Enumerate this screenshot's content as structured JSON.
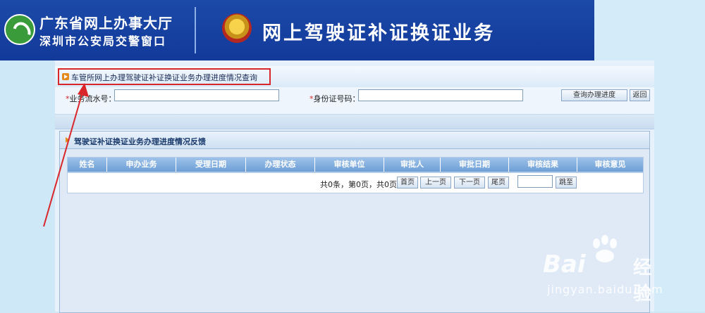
{
  "banner": {
    "portal_line1": "广东省网上办事大厅",
    "portal_line2": "深圳市公安局交警窗口",
    "service_title": "网上驾驶证补证换证业务"
  },
  "breadcrumb": {
    "text": "车管所网上办理驾驶证补证换证业务办理进度情况查询"
  },
  "search": {
    "serial_label": "业务流水号：",
    "serial_value": "",
    "id_label": "身份证号码：",
    "id_value": "",
    "query_button": "查询办理进度",
    "back_button": "返回"
  },
  "results": {
    "title": "驾驶证补证换证业务办理进度情况反馈",
    "columns": [
      "姓名",
      "申办业务",
      "受理日期",
      "办理状态",
      "审核单位",
      "审批人",
      "审批日期",
      "审核结果",
      "审核意见"
    ],
    "rows": []
  },
  "pagination": {
    "info": "共0条，第0页，共0页",
    "first": "首页",
    "prev": "上一页",
    "next": "下一页",
    "last": "尾页",
    "page_input": "",
    "jump": "跳至"
  },
  "watermark": {
    "brand_text": "Bai",
    "brand_suffix": "经验",
    "url": "jingyan.baidu.com"
  },
  "colors": {
    "banner_blue": "#1c4aa8",
    "highlight_red": "#d9262a",
    "header_blue": "#6d9fd6",
    "page_bg": "#cfe8f8"
  }
}
